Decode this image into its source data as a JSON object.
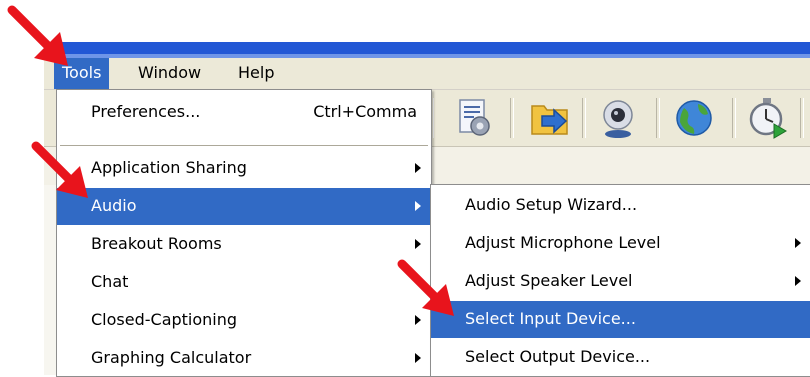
{
  "menubar": {
    "items": [
      {
        "label": "Tools"
      },
      {
        "label": "Window"
      },
      {
        "label": "Help"
      }
    ]
  },
  "tools_menu": {
    "items": [
      {
        "label": "Preferences...",
        "accel": "Ctrl+Comma"
      },
      {
        "label": "Application Sharing"
      },
      {
        "label": "Audio"
      },
      {
        "label": "Breakout Rooms"
      },
      {
        "label": "Chat"
      },
      {
        "label": "Closed-Captioning"
      },
      {
        "label": "Graphing Calculator"
      }
    ]
  },
  "audio_submenu": {
    "items": [
      {
        "label": "Audio Setup Wizard..."
      },
      {
        "label": "Adjust Microphone Level"
      },
      {
        "label": "Adjust Speaker Level"
      },
      {
        "label": "Select Input Device..."
      },
      {
        "label": "Select Output Device..."
      }
    ]
  },
  "toolbar": {
    "icons": [
      "settings-document-icon",
      "folder-arrow-icon",
      "webcam-icon",
      "globe-icon",
      "stopwatch-play-icon"
    ]
  },
  "colors": {
    "highlight": "#316ac5",
    "annotation_arrow": "#e8141c",
    "menubar_bg": "#ece9d8",
    "titlebar": "#2257d5"
  }
}
